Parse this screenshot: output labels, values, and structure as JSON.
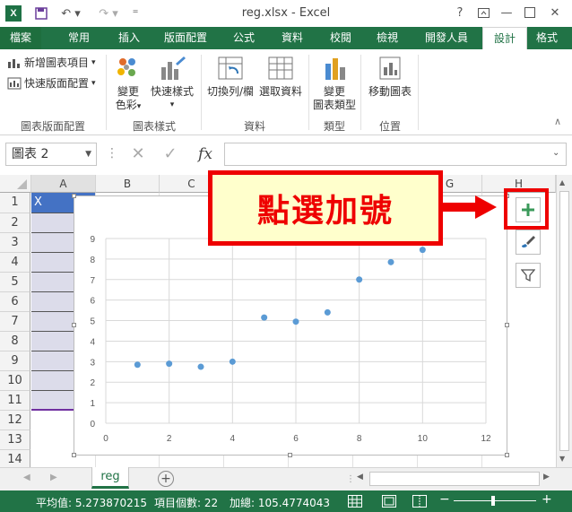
{
  "title_bar": {
    "app_icon": "X",
    "window_title": "reg.xlsx - Excel",
    "help_label": "?"
  },
  "ribbon_tabs": [
    "檔案",
    "常用",
    "插入",
    "版面配置",
    "公式",
    "資料",
    "校閱",
    "檢視",
    "開發人員",
    "設計",
    "格式"
  ],
  "ribbon": {
    "add_chart_element": "新增圖表項目",
    "quick_layout": "快速版面配置",
    "change_colors_1": "變更",
    "change_colors_2": "色彩",
    "quick_styles": "快速樣式",
    "switch_row_col": "切換列/欄",
    "select_data": "選取資料",
    "change_type_1": "變更",
    "change_type_2": "圖表類型",
    "move_chart": "移動圖表",
    "groups": {
      "layouts": "圖表版面配置",
      "styles": "圖表樣式",
      "data": "資料",
      "type": "類型",
      "location": "位置"
    }
  },
  "formula_bar": {
    "name_box": "圖表 2",
    "fx": "fx",
    "formula_value": ""
  },
  "grid": {
    "columns": [
      "A",
      "B",
      "C",
      "D",
      "E",
      "F",
      "G",
      "H"
    ],
    "rows": [
      "1",
      "2",
      "3",
      "4",
      "5",
      "6",
      "7",
      "8",
      "9",
      "10",
      "11",
      "12",
      "13",
      "14"
    ],
    "cell_a1": "X"
  },
  "callout_text": "點選加號",
  "sheet_tab": "reg",
  "status_bar": {
    "average": "平均值: 5.273870215",
    "count": "項目個數: 22",
    "sum": "加總: 105.4774043"
  },
  "chart_data": {
    "type": "scatter",
    "title": "",
    "xlabel": "",
    "ylabel": "",
    "xlim": [
      0,
      12
    ],
    "ylim": [
      0,
      9
    ],
    "x_ticks": [
      0,
      2,
      4,
      6,
      8,
      10,
      12
    ],
    "y_ticks": [
      0,
      1,
      2,
      3,
      4,
      5,
      6,
      7,
      8,
      9
    ],
    "grid": true,
    "color": "#5b9bd5",
    "x": [
      1,
      2,
      3,
      4,
      5,
      6,
      7,
      8,
      9,
      10
    ],
    "y": [
      2.85,
      2.9,
      2.75,
      3.0,
      5.15,
      4.95,
      5.4,
      7.0,
      7.85,
      8.45
    ]
  },
  "colors": {
    "excel_green": "#217346",
    "callout_red": "#ee0000",
    "callout_fill": "#ffffcc"
  }
}
